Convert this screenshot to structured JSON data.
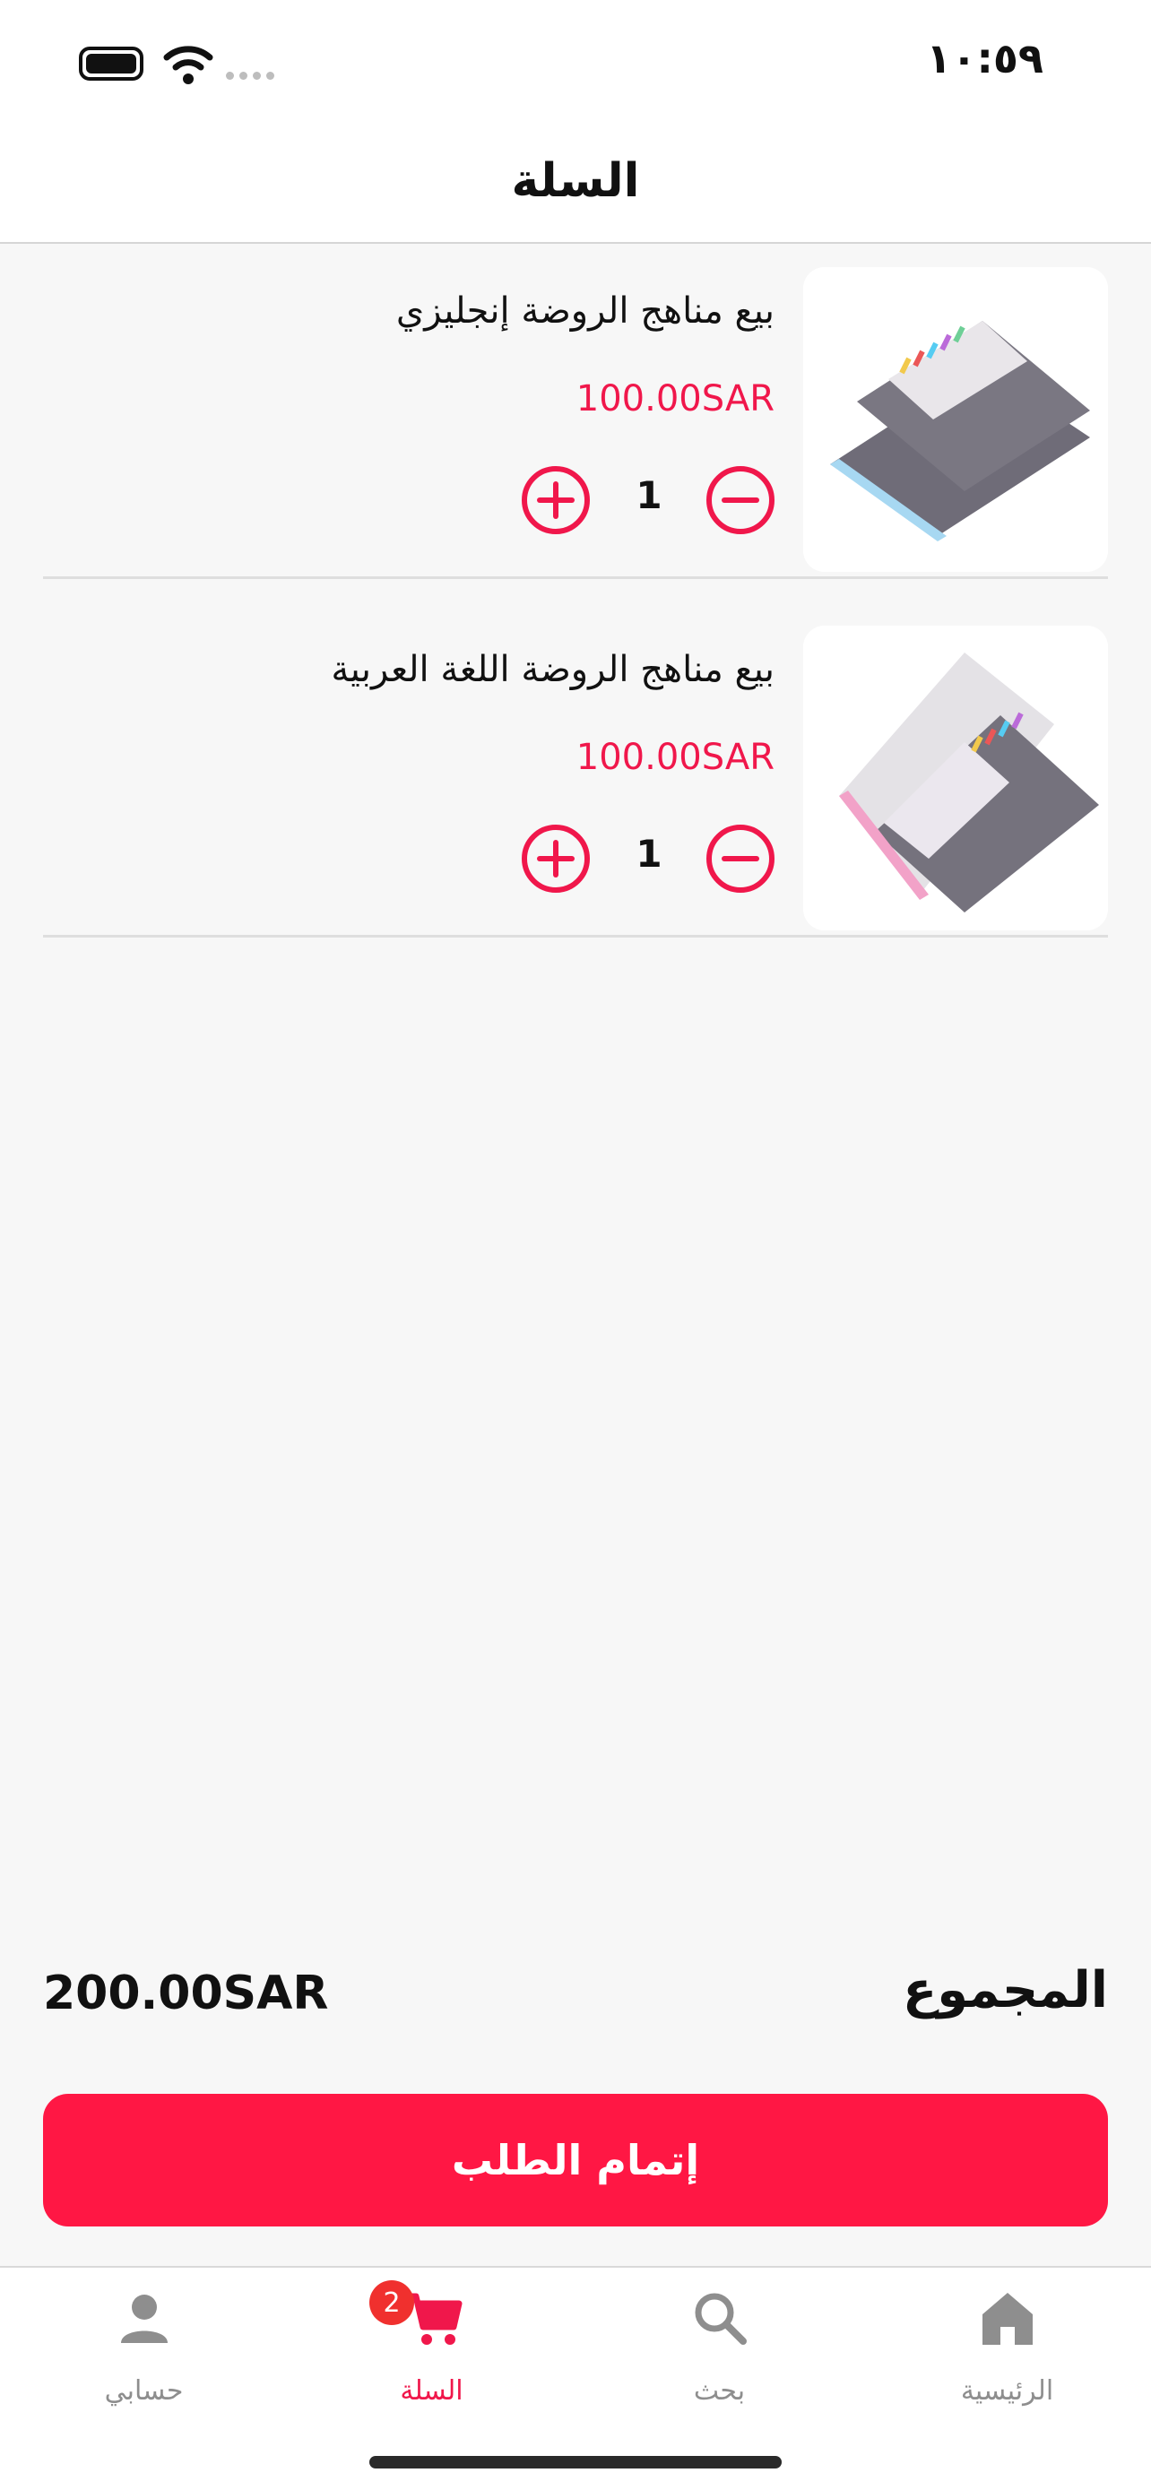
{
  "status_bar": {
    "time": "١٠:٥٩"
  },
  "header": {
    "title": "السلة"
  },
  "cart": {
    "items": [
      {
        "title": "بيع مناهج الروضة إنجليزي",
        "price": "100.00SAR",
        "quantity": "1",
        "image_icon": "english-book-image"
      },
      {
        "title": "بيع مناهج الروضة اللغة العربية",
        "price": "100.00SAR",
        "quantity": "1",
        "image_icon": "arabic-book-image"
      }
    ]
  },
  "summary": {
    "total_label": "المجموع",
    "total_value": "200.00SAR"
  },
  "checkout": {
    "label": "إتمام الطلب"
  },
  "tabbar": {
    "tabs": [
      {
        "label": "حسابي",
        "icon": "person-icon"
      },
      {
        "label": "السلة",
        "icon": "cart-icon",
        "badge": "2",
        "active": true
      },
      {
        "label": "بحث",
        "icon": "search-icon"
      },
      {
        "label": "الرئيسية",
        "icon": "home-icon"
      }
    ]
  },
  "colors": {
    "accent": "#ff1744",
    "price": "#f0174b",
    "inactive": "#8e8e8e",
    "background": "#f7f7f7"
  }
}
